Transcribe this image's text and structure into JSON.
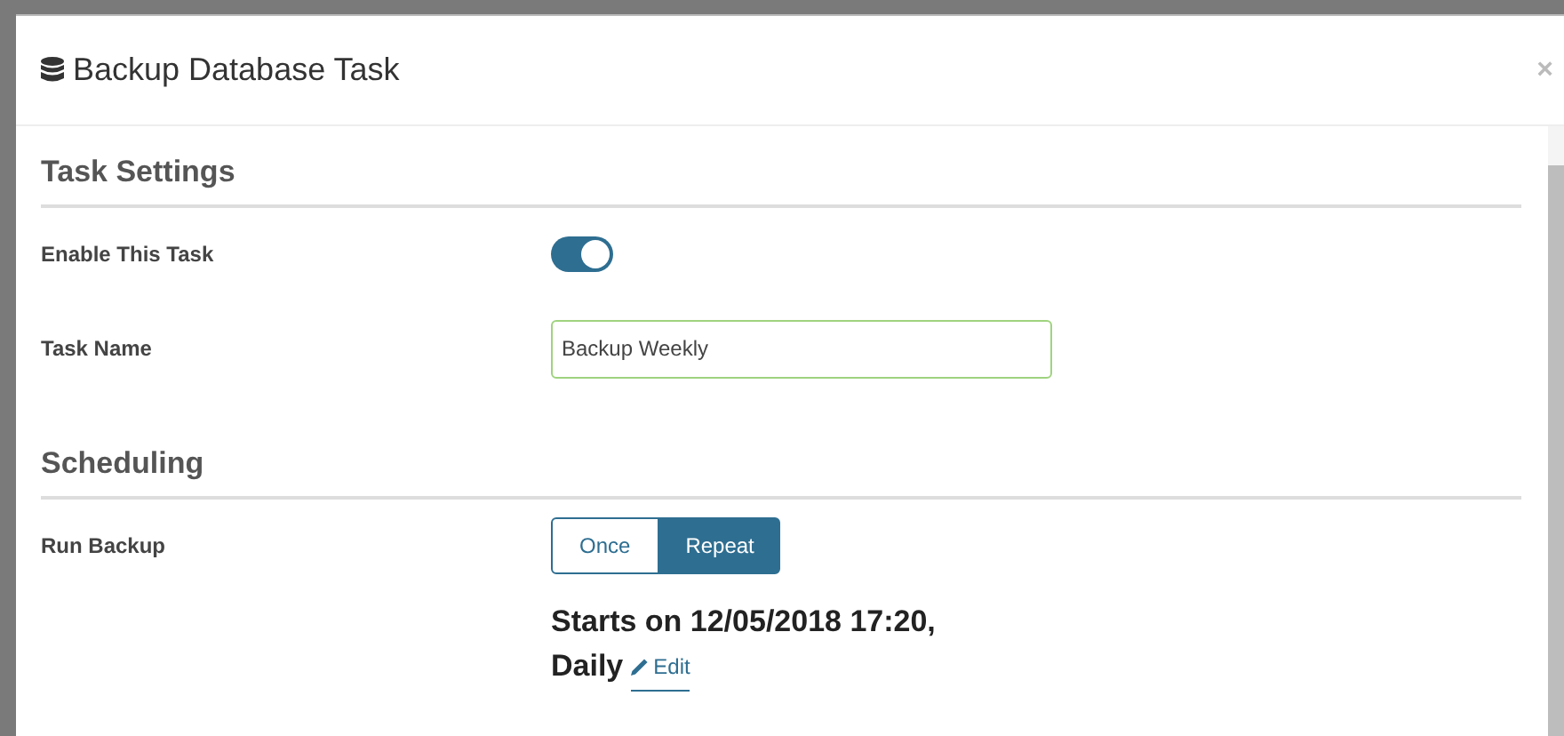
{
  "dialog": {
    "title": "Backup Database Task",
    "close": "×"
  },
  "sections": [
    {
      "heading": "Task Settings",
      "rows": [
        {
          "kind": "toggle",
          "label": "Enable This Task",
          "on": true
        },
        {
          "kind": "text",
          "label": "Task Name",
          "value": "Backup Weekly"
        }
      ]
    },
    {
      "heading": "Scheduling",
      "rows": [
        {
          "kind": "segments",
          "label": "Run Backup",
          "options": [
            {
              "label": "Once",
              "selected": false
            },
            {
              "label": "Repeat",
              "selected": true
            }
          ],
          "summary": "Starts on 12/05/2018 17:20, Daily",
          "link": "Edit"
        }
      ]
    }
  ]
}
